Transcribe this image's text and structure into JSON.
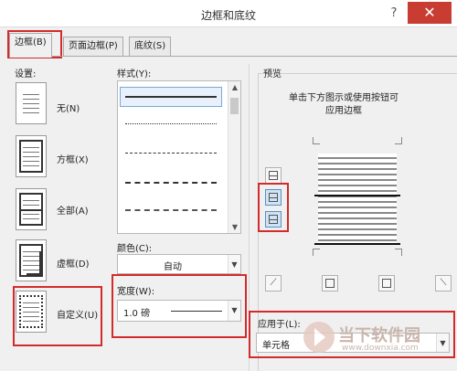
{
  "window": {
    "title": "边框和底纹",
    "help_label": "?",
    "close_label": "✕"
  },
  "tabs": [
    {
      "label": "边框(B)",
      "active": true
    },
    {
      "label": "页面边框(P)",
      "active": false
    },
    {
      "label": "底纹(S)",
      "active": false
    }
  ],
  "settings": {
    "heading": "设置:",
    "items": [
      {
        "label": "无(N)",
        "icon": "border-none-icon"
      },
      {
        "label": "方框(X)",
        "icon": "border-box-icon"
      },
      {
        "label": "全部(A)",
        "icon": "border-all-icon"
      },
      {
        "label": "虚框(D)",
        "icon": "border-grid-icon"
      },
      {
        "label": "自定义(U)",
        "icon": "border-custom-icon",
        "selected": true
      }
    ]
  },
  "style": {
    "heading": "样式(Y):",
    "options": [
      "solid",
      "dotted",
      "dashed-fine",
      "dashed",
      "dash-dot",
      "dash-dot-dot"
    ]
  },
  "color": {
    "heading": "颜色(C):",
    "value": "自动"
  },
  "width": {
    "heading": "宽度(W):",
    "value": "1.0 磅"
  },
  "preview": {
    "heading": "预览",
    "instruction_line1": "单击下方图示或使用按钮可",
    "instruction_line2": "应用边框"
  },
  "apply_to": {
    "heading": "应用于(L):",
    "value": "单元格"
  },
  "watermark": {
    "brand": "当下软件园",
    "url": "www.downxia.com"
  },
  "colors": {
    "highlight": "#d32b2b",
    "close_button": "#c83c32",
    "toggle_on": "#cfe3f5"
  }
}
